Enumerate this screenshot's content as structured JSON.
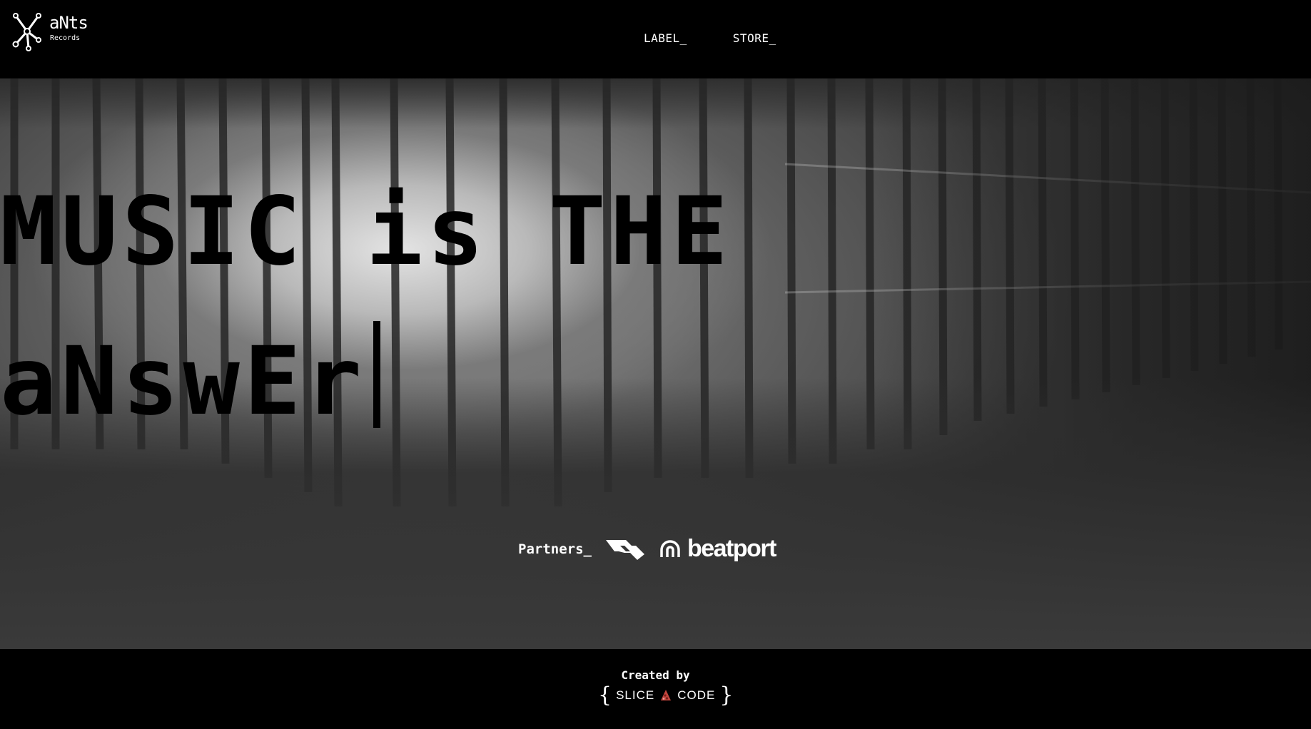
{
  "header": {
    "logo": {
      "text": "aNts",
      "sub": "Records",
      "icon": "molecule-logo-icon"
    },
    "nav": [
      {
        "label": "LABEL_"
      },
      {
        "label": "STORE_"
      }
    ]
  },
  "hero": {
    "title_line1": "MUSIC is THE",
    "title_line2": "aNswEr",
    "partners_label": "Partners_",
    "partners": [
      {
        "name": "ra",
        "icon": "resident-advisor-logo-icon"
      },
      {
        "name": "beatport",
        "icon": "beatport-logo-icon"
      }
    ]
  },
  "footer": {
    "created_by": "Created by",
    "credit_left": "SLICE",
    "credit_right": "CODE",
    "credit_icon": "pizza-slice-icon"
  },
  "colors": {
    "background": "#000000",
    "text": "#ffffff",
    "hero_title": "#000000"
  }
}
